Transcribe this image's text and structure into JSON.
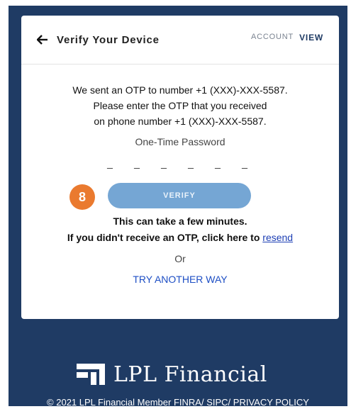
{
  "header": {
    "title": "Verify Your Device",
    "account_label": "ACCOUNT",
    "view_label": "VIEW"
  },
  "message": {
    "line1": "We sent an OTP to number +1 (XXX)-XXX-5587.",
    "line2": "Please enter the OTP that you received",
    "line3": "on phone number +1 (XXX)-XXX-5587."
  },
  "otp": {
    "label": "One-Time Password",
    "digits": [
      "_",
      "_",
      "_",
      "_",
      "_",
      "_"
    ]
  },
  "step_badge": "8",
  "verify_button": "VERIFY",
  "wait_message": "This can take a few minutes.",
  "resend": {
    "prefix": "If you didn't receive an OTP, click here to ",
    "link": "resend"
  },
  "or_text": "Or",
  "try_another": "TRY ANOTHER WAY",
  "brand": {
    "name": "LPL Financial"
  },
  "footer": {
    "prefix": "© 2021 LPL Financial Member ",
    "finra": "FINRA",
    "sep1": "/ ",
    "sipc": "SIPC",
    "sep2": "/ ",
    "privacy": "PRIVACY POLICY"
  },
  "colors": {
    "navy": "#1f3b64",
    "verify_button": "#75a6d4",
    "badge": "#ea7a2f",
    "link": "#1d3fb4"
  }
}
